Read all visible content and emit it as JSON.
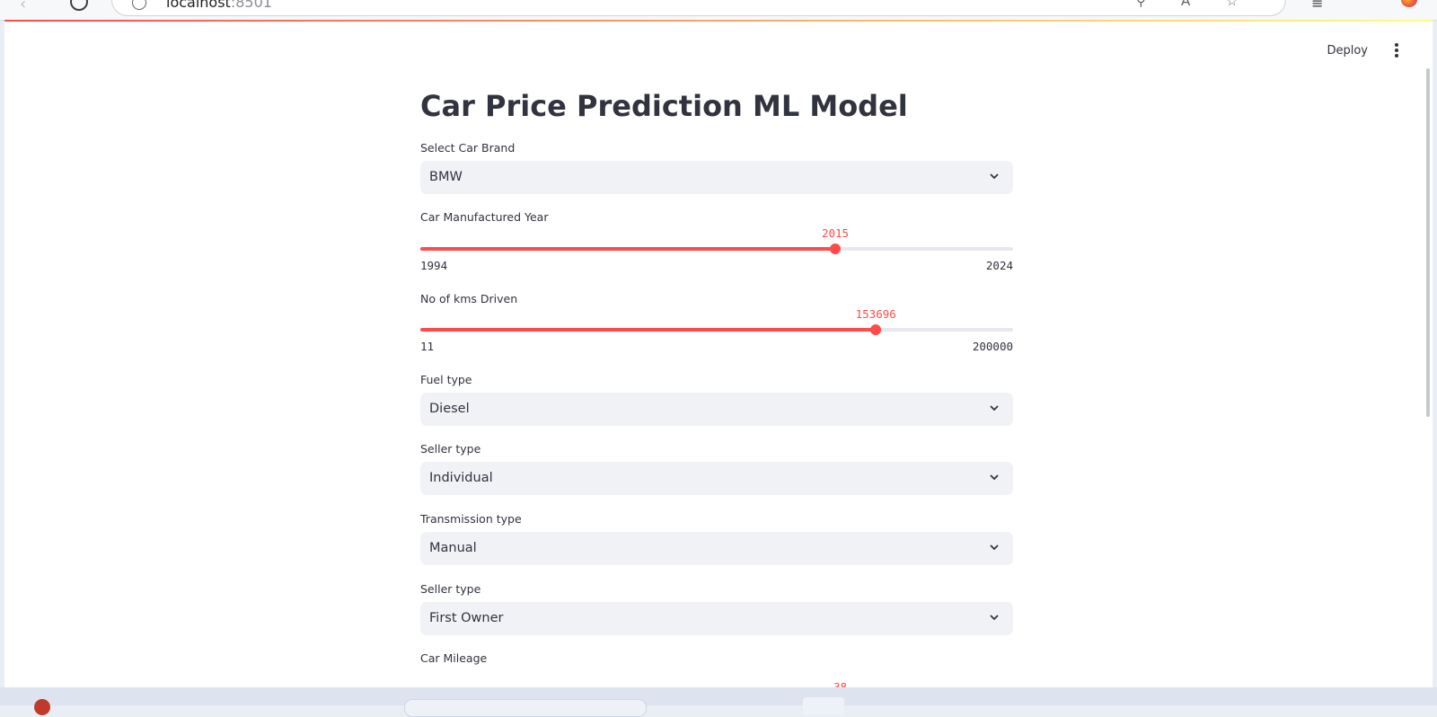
{
  "browser": {
    "address_host": "localhost",
    "address_port": ":8501"
  },
  "toolbar": {
    "deploy_label": "Deploy"
  },
  "title": "Car Price Prediction ML Model",
  "fields": {
    "brand": {
      "label": "Select Car Brand",
      "value": "BMW"
    },
    "year": {
      "label": "Car Manufactured Year",
      "min": "1994",
      "max": "2024",
      "value": "2015"
    },
    "kms": {
      "label": "No of kms Driven",
      "min": "11",
      "max": "200000",
      "value": "153696"
    },
    "fuel": {
      "label": "Fuel type",
      "value": "Diesel"
    },
    "seller": {
      "label": "Seller type",
      "value": "Individual"
    },
    "transmission": {
      "label": "Transmission type",
      "value": "Manual"
    },
    "owner": {
      "label": "Seller type",
      "value": "First Owner"
    },
    "mileage": {
      "label": "Car Mileage",
      "value_partial": "38"
    }
  },
  "sliders": {
    "year_fraction": 0.7,
    "kms_fraction": 0.7685
  },
  "colors": {
    "accent": "#ff4b4b",
    "select_bg": "#f0f2f6",
    "text": "#31333f"
  }
}
